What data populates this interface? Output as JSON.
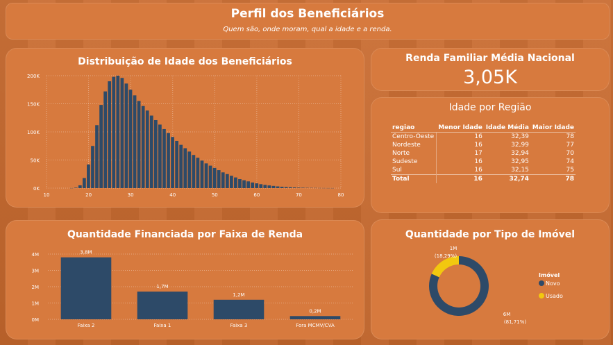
{
  "header": {
    "title": "Perfil dos Beneficiários",
    "subtitle": "Quem são, onde moram, qual a idade e a renda."
  },
  "kpi": {
    "label": "Renda Familiar Média Nacional",
    "value": "3,05K"
  },
  "region_table": {
    "title": "Idade por Região",
    "columns": [
      "regiao",
      "Menor Idade",
      "Idade Média",
      "Maior Idade"
    ],
    "rows": [
      [
        "Centro-Oeste",
        "16",
        "32,39",
        "78"
      ],
      [
        "Nordeste",
        "16",
        "32,99",
        "77"
      ],
      [
        "Norte",
        "17",
        "32,94",
        "70"
      ],
      [
        "Sudeste",
        "16",
        "32,95",
        "74"
      ],
      [
        "Sul",
        "16",
        "32,15",
        "75"
      ]
    ],
    "total": [
      "Total",
      "16",
      "32,74",
      "78"
    ]
  },
  "colors": {
    "bar": "#2d4a68",
    "accent": "#f2c80f",
    "card": "#d77a3e",
    "background": "#c8692d"
  },
  "chart_data": [
    {
      "id": "histogram",
      "type": "bar",
      "title": "Distribuição de Idade dos Beneficiários",
      "x": [
        16,
        17,
        18,
        19,
        20,
        21,
        22,
        23,
        24,
        25,
        26,
        27,
        28,
        29,
        30,
        31,
        32,
        33,
        34,
        35,
        36,
        37,
        38,
        39,
        40,
        41,
        42,
        43,
        44,
        45,
        46,
        47,
        48,
        49,
        50,
        51,
        52,
        53,
        54,
        55,
        56,
        57,
        58,
        59,
        60,
        61,
        62,
        63,
        64,
        65,
        66,
        67,
        68,
        69,
        70,
        71,
        72,
        73,
        74,
        75,
        76,
        77,
        78
      ],
      "values": [
        100,
        800,
        5000,
        18000,
        42000,
        75000,
        112000,
        148000,
        172000,
        190000,
        198000,
        200000,
        196000,
        186000,
        175000,
        165000,
        155000,
        146000,
        138000,
        129000,
        121000,
        113000,
        105000,
        98000,
        91000,
        84000,
        77000,
        71000,
        65000,
        59000,
        54000,
        49000,
        44000,
        40000,
        36000,
        32000,
        28000,
        25000,
        22000,
        19000,
        16000,
        14000,
        12000,
        10000,
        8500,
        7000,
        5800,
        4800,
        3900,
        3100,
        2500,
        2000,
        1600,
        1200,
        900,
        700,
        500,
        400,
        300,
        200,
        150,
        100,
        80
      ],
      "xlim": [
        10,
        80
      ],
      "xticks": [
        "10",
        "20",
        "30",
        "40",
        "50",
        "60",
        "70",
        "80"
      ],
      "ylim": [
        0,
        200000
      ],
      "yticks": [
        {
          "v": 0,
          "label": "0K"
        },
        {
          "v": 50000,
          "label": "50K"
        },
        {
          "v": 100000,
          "label": "100K"
        },
        {
          "v": 150000,
          "label": "150K"
        },
        {
          "v": 200000,
          "label": "200K"
        }
      ],
      "grid": true
    },
    {
      "id": "faixa",
      "type": "bar",
      "title": "Quantidade Financiada por Faixa de Renda",
      "categories": [
        "Faixa 2",
        "Faixa 1",
        "Faixa 3",
        "Fora MCMV/CVA"
      ],
      "values": [
        3.8,
        1.7,
        1.2,
        0.2
      ],
      "data_labels": [
        "3,8M",
        "1,7M",
        "1,2M",
        "0,2M"
      ],
      "ylim": [
        0,
        4
      ],
      "yticks": [
        "0M",
        "1M",
        "2M",
        "3M",
        "4M"
      ],
      "grid": true
    },
    {
      "id": "imovel",
      "type": "pie",
      "title": "Quantidade por Tipo de Imóvel",
      "legend_title": "Imóvel",
      "labels": [
        "Novo",
        "Usado"
      ],
      "values": [
        81.71,
        18.29
      ],
      "value_labels": [
        "6M",
        "1M"
      ],
      "pct_labels": [
        "(81,71%)",
        "(18,29%)"
      ],
      "colors": [
        "#2d4a68",
        "#f2c80f"
      ],
      "legend": "right"
    }
  ]
}
